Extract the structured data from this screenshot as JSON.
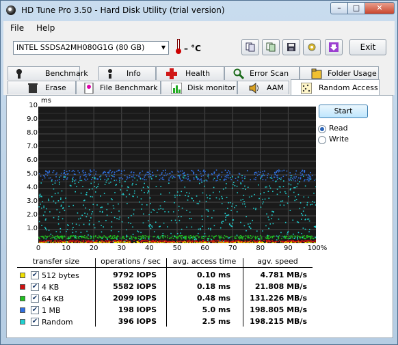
{
  "window": {
    "title": "HD Tune Pro 3.50 - Hard Disk Utility (trial version)"
  },
  "titlebar_buttons": {
    "minimize": "–",
    "maximize": "□",
    "close": "✕"
  },
  "menu": {
    "items": [
      "File",
      "Help"
    ]
  },
  "toolbar": {
    "drive": "INTEL SSDSA2MH080G1G (80 GB)",
    "temperature": "– °C",
    "exit_label": "Exit",
    "icons": [
      "copy-info-icon",
      "copy-screen-icon",
      "save-icon",
      "options-icon",
      "download-icon"
    ]
  },
  "tabs": {
    "row1": [
      {
        "label": "Benchmark",
        "icon": "benchmark-icon"
      },
      {
        "label": "Info",
        "icon": "info-icon"
      },
      {
        "label": "Health",
        "icon": "health-icon"
      },
      {
        "label": "Error Scan",
        "icon": "error-scan-icon"
      },
      {
        "label": "Folder Usage",
        "icon": "folder-usage-icon"
      }
    ],
    "row2": [
      {
        "label": "Erase",
        "icon": "erase-icon"
      },
      {
        "label": "File Benchmark",
        "icon": "file-benchmark-icon"
      },
      {
        "label": "Disk monitor",
        "icon": "disk-monitor-icon"
      },
      {
        "label": "AAM",
        "icon": "aam-icon"
      },
      {
        "label": "Random Access",
        "icon": "random-access-icon",
        "active": true
      }
    ]
  },
  "controls": {
    "start_label": "Start",
    "read_label": "Read",
    "write_label": "Write",
    "selected": "Read"
  },
  "chart_data": {
    "type": "scatter",
    "ylabel": "ms",
    "ylim": [
      0,
      10
    ],
    "xlim": [
      0,
      100
    ],
    "yticks": [
      "10",
      "9.0",
      "8.0",
      "7.0",
      "6.0",
      "5.0",
      "4.0",
      "3.0",
      "2.0",
      "1.0"
    ],
    "xticks": [
      "0",
      "10",
      "20",
      "30",
      "40",
      "50",
      "60",
      "70",
      "80",
      "90",
      "100%"
    ],
    "grid": true,
    "series": [
      {
        "name": "512 bytes",
        "color": "#f0e000",
        "band": [
          0.05,
          0.15
        ]
      },
      {
        "name": "4 KB",
        "color": "#d01010",
        "band": [
          0.12,
          0.25
        ]
      },
      {
        "name": "64 KB",
        "color": "#20c020",
        "band": [
          0.35,
          0.6
        ]
      },
      {
        "name": "1 MB",
        "color": "#3070e0",
        "band": [
          4.6,
          5.4
        ]
      },
      {
        "name": "Random",
        "color": "#20d0d0",
        "band": [
          0.1,
          5.0
        ]
      }
    ]
  },
  "results": {
    "headers": [
      "transfer size",
      "operations / sec",
      "avg. access time",
      "agv. speed"
    ],
    "rows": [
      {
        "name": "512 bytes",
        "color": "#f0e000",
        "ops": "9792 IOPS",
        "access": "0.10 ms",
        "speed": "4.781 MB/s"
      },
      {
        "name": "4 KB",
        "color": "#d01010",
        "ops": "5582 IOPS",
        "access": "0.18 ms",
        "speed": "21.808 MB/s"
      },
      {
        "name": "64 KB",
        "color": "#20c020",
        "ops": "2099 IOPS",
        "access": "0.48 ms",
        "speed": "131.226 MB/s"
      },
      {
        "name": "1 MB",
        "color": "#3070e0",
        "ops": "198 IOPS",
        "access": "5.0 ms",
        "speed": "198.805 MB/s"
      },
      {
        "name": "Random",
        "color": "#20d0d0",
        "ops": "396 IOPS",
        "access": "2.5 ms",
        "speed": "198.215 MB/s"
      }
    ]
  }
}
